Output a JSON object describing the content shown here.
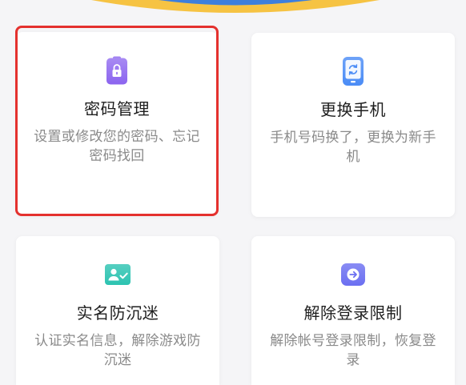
{
  "page": {
    "background": "#f5f5f7"
  },
  "banner": {
    "ring_color": "#f6c343",
    "center_color": "#3d7fdc"
  },
  "highlight": {
    "color": "#e4312e"
  },
  "cards": [
    {
      "title": "密码管理",
      "description": "设置或修改您的密码、忘记密码找回",
      "icon": "lock-icon",
      "icon_color": "#8b64ef",
      "highlighted": true
    },
    {
      "title": "更换手机",
      "description": "手机号码换了，更换为新手机",
      "icon": "phone-refresh-icon",
      "icon_color": "#4b8cf6",
      "highlighted": false
    },
    {
      "title": "实名防沉迷",
      "description": "认证实名信息，解除游戏防沉迷",
      "icon": "id-card-check-icon",
      "icon_color": "#2cc3b1",
      "highlighted": false
    },
    {
      "title": "解除登录限制",
      "description": "解除帐号登录限制，恢复登录",
      "icon": "unlock-arrow-icon",
      "icon_color": "#6b6ff1",
      "highlighted": false
    }
  ]
}
